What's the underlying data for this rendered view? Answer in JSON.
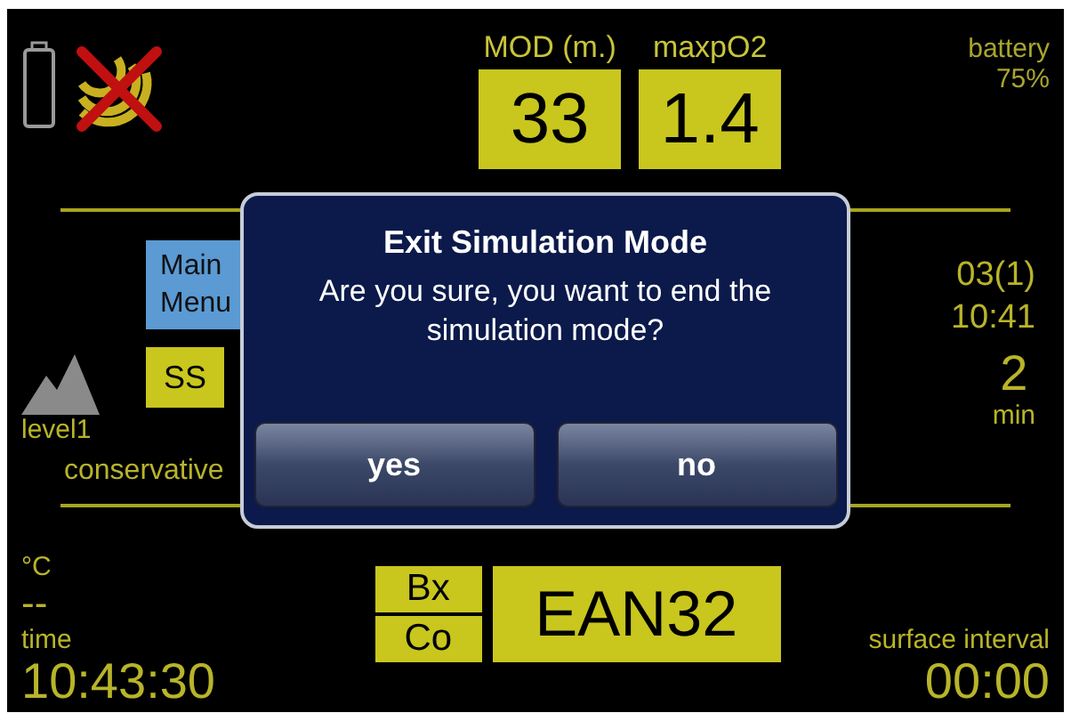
{
  "status": {
    "battery_label": "battery",
    "battery_value": "75%"
  },
  "limits": [
    {
      "label": "MOD (m.)",
      "value": "33"
    },
    {
      "label": "maxpO2",
      "value": "1.4"
    }
  ],
  "altitude": {
    "label": "level1"
  },
  "menu_buttons": [
    "Main Menu"
  ],
  "gradient": {
    "badge": "SS",
    "label": "conservative"
  },
  "last_dive": {
    "title": "03(1)",
    "time": "10:41",
    "duration": "2",
    "duration_unit": "min"
  },
  "temperature": {
    "unit": "°C",
    "value": "--"
  },
  "clock": {
    "label": "time",
    "value": "10:43:30"
  },
  "gas": {
    "top": "Bx",
    "bottom": "Co",
    "mix": "EAN32"
  },
  "surface_interval": {
    "label": "surface interval",
    "value": "00:00"
  },
  "dialog": {
    "title": "Exit Simulation Mode",
    "message": "Are you sure, you want to end the simulation mode?",
    "buttons": [
      "yes",
      "no"
    ]
  }
}
